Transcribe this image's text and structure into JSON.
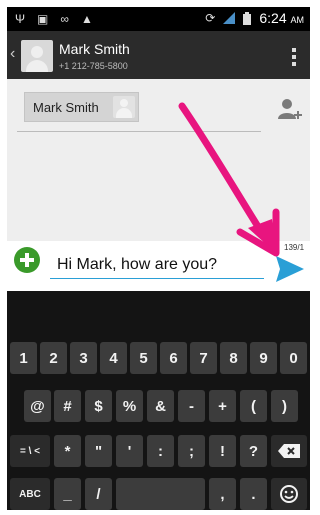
{
  "status_bar": {
    "time": "6:24",
    "ampm": "AM",
    "left_icons": [
      "usb-icon",
      "image-icon",
      "voicemail-icon",
      "warning-icon"
    ],
    "right_icons": [
      "rotation-icon",
      "signal-icon",
      "battery-icon"
    ]
  },
  "header": {
    "contact_name": "Mark Smith",
    "contact_phone": "+1 212-785-5800"
  },
  "recipient": {
    "chip_label": "Mark Smith"
  },
  "composer": {
    "message": "Hi Mark, how are you?",
    "counter": "139/1"
  },
  "keyboard": {
    "row1": [
      "1",
      "2",
      "3",
      "4",
      "5",
      "6",
      "7",
      "8",
      "9",
      "0"
    ],
    "row2": [
      "@",
      "#",
      "$",
      "%",
      "&",
      "-",
      "+",
      "(",
      ")"
    ],
    "row3": [
      "= \\ <",
      "*",
      "\"",
      "'",
      ":",
      ";",
      "!",
      "?"
    ],
    "row4": [
      "ABC",
      "_",
      "/",
      ",",
      "."
    ]
  },
  "colors": {
    "accent_blue": "#2a9fd6",
    "attach_green": "#3a9a2a",
    "annotation_pink": "#e8157f"
  }
}
